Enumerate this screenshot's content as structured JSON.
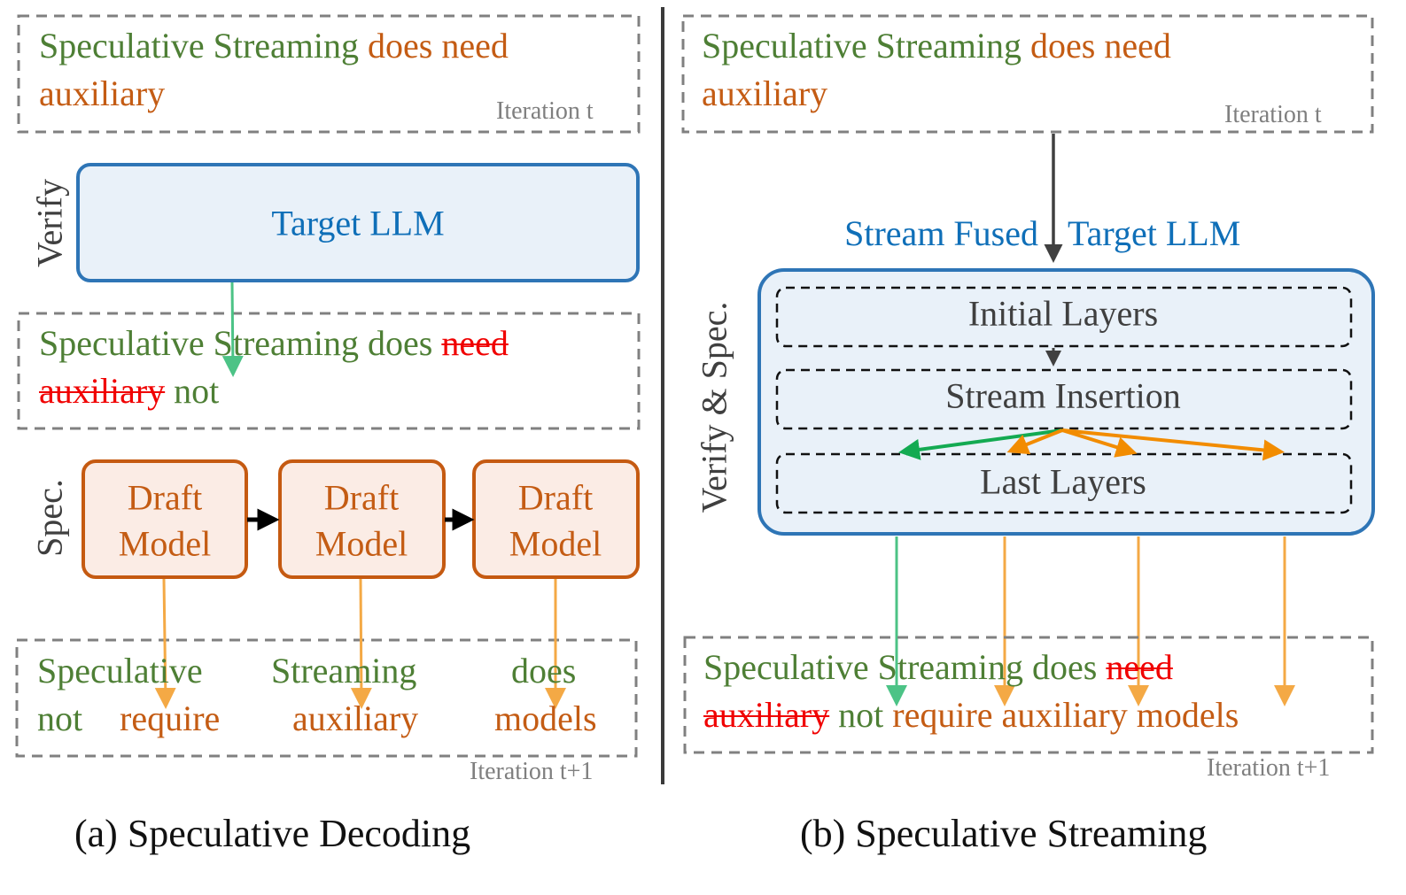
{
  "colors": {
    "accepted_green": "#4e7f35",
    "speculative_orange": "#c45c14",
    "rejected_red": "#f00000",
    "label_gray": "#7f7f7f",
    "llm_blue": "#0f6fb8",
    "llm_box_stroke": "#2e75b6",
    "llm_box_fill": "#e9f1f9",
    "draft_box_stroke": "#c55a11",
    "draft_box_fill": "#fbece5",
    "arrow_green": "#4cc386",
    "arrow_orange": "#f4a945",
    "inner_arrow_green": "#13aa52",
    "inner_arrow_orange": "#f28c00"
  },
  "panel_a": {
    "iter_t_box": {
      "line1": [
        {
          "text": "Speculative Streaming",
          "role": "accepted"
        },
        {
          "text": "does need",
          "role": "speculative"
        }
      ],
      "line2": [
        {
          "text": "auxiliary",
          "role": "speculative"
        }
      ],
      "label": "Iteration t"
    },
    "verify_label": "Verify",
    "target_llm_label": "Target LLM",
    "verified_box": {
      "line1": [
        {
          "text": "Speculative Streaming does",
          "role": "accepted"
        },
        {
          "text": "need",
          "role": "rejected"
        }
      ],
      "line2": [
        {
          "text": "auxiliary",
          "role": "rejected"
        },
        {
          "text": "not",
          "role": "accepted"
        }
      ]
    },
    "spec_label": "Spec.",
    "draft_models": [
      {
        "line1": "Draft",
        "line2": "Model"
      },
      {
        "line1": "Draft",
        "line2": "Model"
      },
      {
        "line1": "Draft",
        "line2": "Model"
      }
    ],
    "iter_t1_box": {
      "columns": [
        {
          "top": "Speculative",
          "bottom_left": "not",
          "bottom": "require"
        },
        {
          "top": "Streaming",
          "bottom": "auxiliary"
        },
        {
          "top": "does",
          "bottom": "models"
        }
      ],
      "label": "Iteration t+1"
    },
    "caption": "(a) Speculative Decoding"
  },
  "panel_b": {
    "iter_t_box": {
      "line1": [
        {
          "text": "Speculative Streaming",
          "role": "accepted"
        },
        {
          "text": "does need",
          "role": "speculative"
        }
      ],
      "line2": [
        {
          "text": "auxiliary",
          "role": "speculative"
        }
      ],
      "label": "Iteration t"
    },
    "model_title_left": "Stream Fused",
    "model_title_right": "Target LLM",
    "side_label": "Verify & Spec.",
    "layers": [
      "Initial Layers",
      "Stream Insertion",
      "Last Layers"
    ],
    "iter_t1_box": {
      "line1": [
        {
          "text": "Speculative Streaming does",
          "role": "accepted"
        },
        {
          "text": "need",
          "role": "rejected"
        }
      ],
      "line2": [
        {
          "text": "auxiliary",
          "role": "rejected"
        },
        {
          "text": "not",
          "role": "accepted"
        },
        {
          "text": "require auxiliary models",
          "role": "speculative"
        }
      ],
      "label": "Iteration t+1"
    },
    "caption": "(b) Speculative Streaming"
  }
}
